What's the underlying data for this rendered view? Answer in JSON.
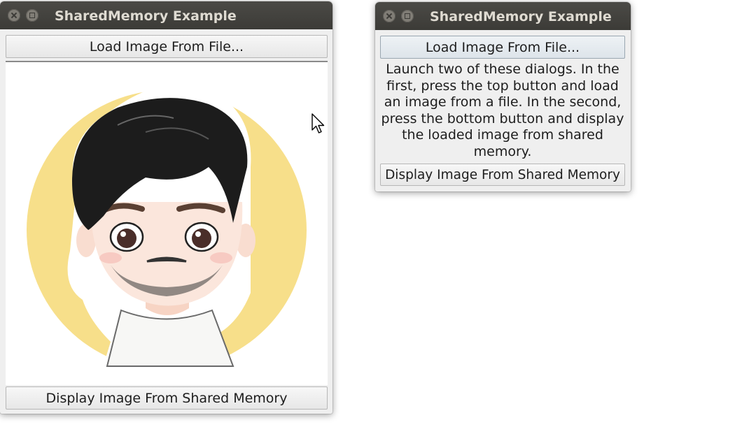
{
  "window_left": {
    "title": "SharedMemory Example",
    "load_button_label": "Load Image From File...",
    "display_button_label": "Display Image From Shared Memory",
    "image": "cartoon-avatar"
  },
  "window_right": {
    "title": "SharedMemory Example",
    "load_button_label": "Load Image From File...",
    "instructions": "Launch two of these dialogs.  In the first, press the top button and load an image from a file.  In the second, press the bottom button and display the loaded image from shared memory.",
    "display_button_label": "Display Image From Shared Memory"
  },
  "icons": {
    "close": "close-icon",
    "maximize": "maximize-icon",
    "cursor": "mouse-pointer-icon"
  },
  "colors": {
    "titlebar": "#3c3b37",
    "title_text": "#dfdbd2",
    "window_bg": "#efefef",
    "avatar_circle": "#f7df8a"
  }
}
